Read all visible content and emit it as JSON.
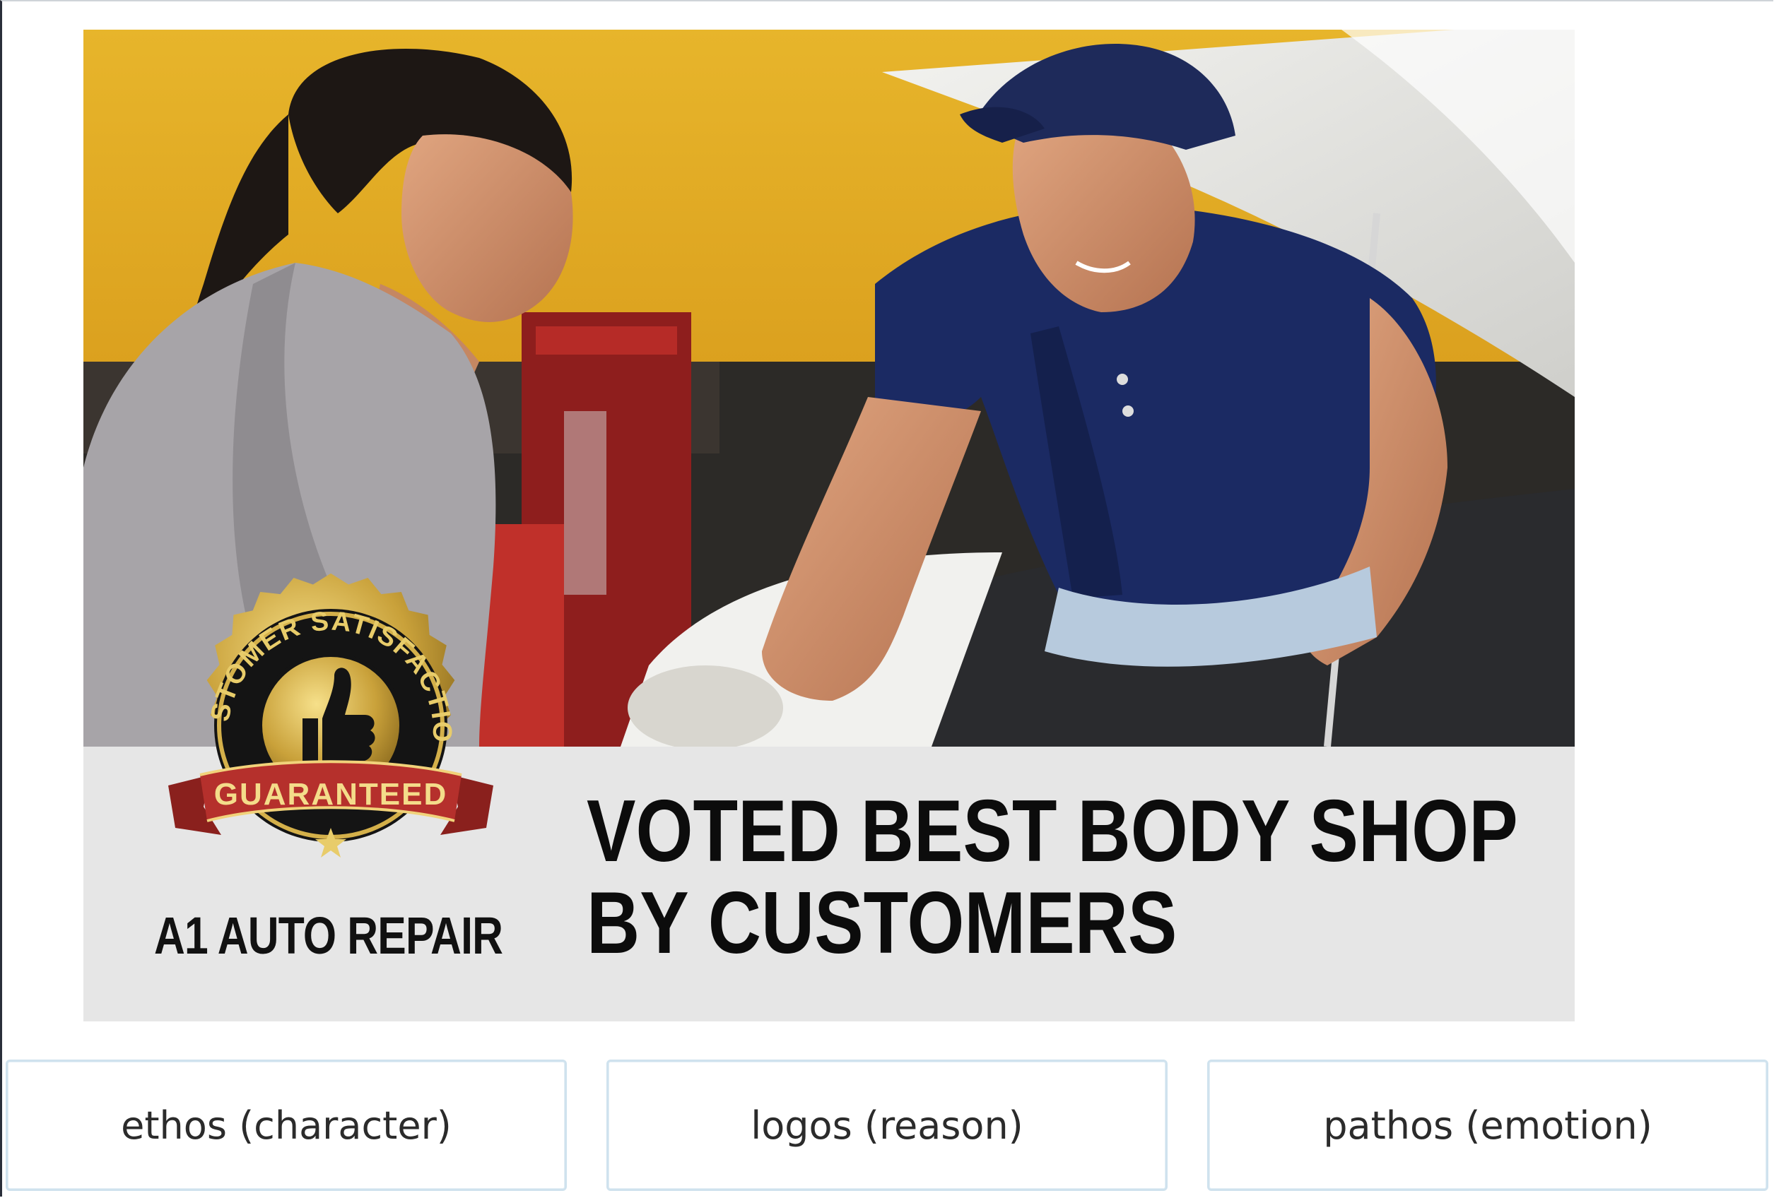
{
  "ad": {
    "seal_top_text": "CUSTOMER SATISFACTION",
    "seal_ribbon_text": "GUARANTEED",
    "brand": "A1 AUTO REPAIR",
    "headline_line1": "VOTED BEST BODY SHOP",
    "headline_line2": "BY CUSTOMERS"
  },
  "choices": [
    {
      "label": "ethos (character)"
    },
    {
      "label": "logos (reason)"
    },
    {
      "label": "pathos (emotion)"
    }
  ],
  "colors": {
    "wall_yellow": "#e9b528",
    "banner_gray": "#e6e6e6",
    "seal_gold": "#c9a13a",
    "ribbon_red": "#b5302c",
    "shirt_navy": "#1b2a63",
    "choice_border": "#cfe2ee"
  }
}
